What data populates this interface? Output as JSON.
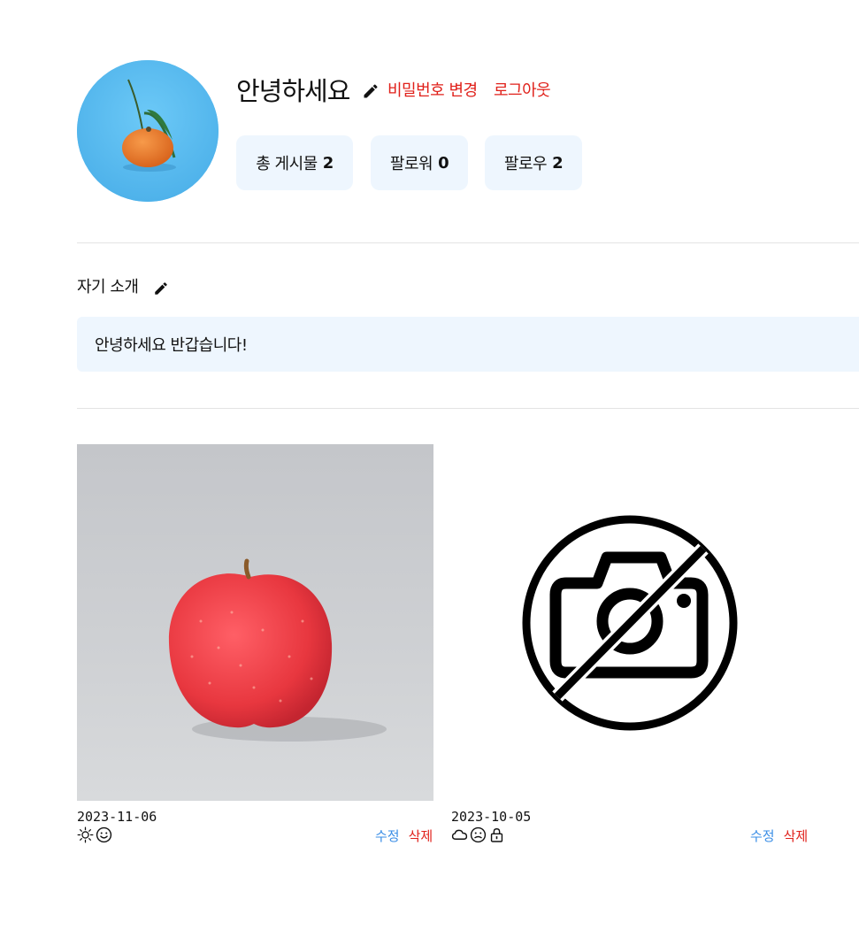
{
  "profile": {
    "username": "안녕하세요",
    "change_password": "비밀번호 변경",
    "logout": "로그아웃",
    "stats": [
      {
        "label": "총 게시물",
        "value": "2"
      },
      {
        "label": "팔로워",
        "value": "0"
      },
      {
        "label": "팔로우",
        "value": "2"
      }
    ]
  },
  "intro": {
    "label": "자기 소개",
    "text": "안녕하세요 반갑습니다!"
  },
  "posts": [
    {
      "date": "2023-11-06",
      "image": "apple-photo",
      "icons": [
        "sun-icon",
        "smile-icon"
      ],
      "edit": "수정",
      "delete": "삭제"
    },
    {
      "date": "2023-10-05",
      "image": "no-image-placeholder",
      "icons": [
        "cloud-icon",
        "neutral-face-icon",
        "lock-icon"
      ],
      "edit": "수정",
      "delete": "삭제"
    }
  ],
  "colors": {
    "accent_red": "#e0201a",
    "accent_blue": "#3a8ee6",
    "stat_bg": "#eef6fe"
  }
}
